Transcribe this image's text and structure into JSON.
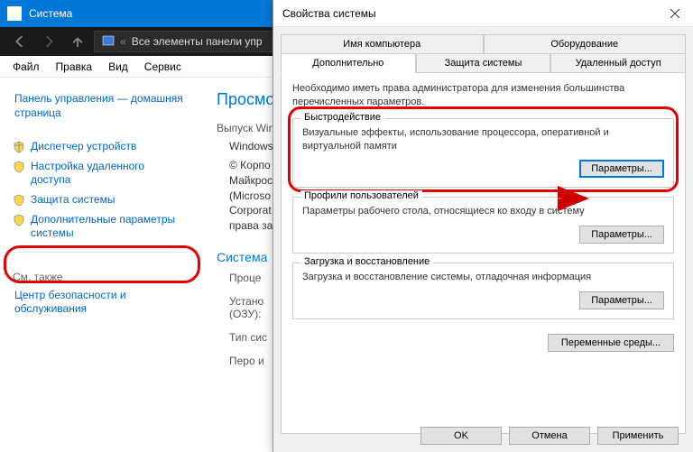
{
  "main_window": {
    "title": "Система",
    "address_crumb": "Все элементы панели упр",
    "menubar": [
      "Файл",
      "Правка",
      "Вид",
      "Сервис"
    ],
    "sidebar": {
      "home": "Панель управления — домашняя страница",
      "items": [
        "Диспетчер устройств",
        "Настройка удаленного доступа",
        "Защита системы",
        "Дополнительные параметры системы"
      ],
      "see_also_header": "См. также",
      "see_also": "Центр безопасности и обслуживания"
    },
    "main": {
      "heading": "Просмот",
      "edition_label": "Выпуск Win",
      "edition_value": "Windows",
      "copyright": "© Корпо\nМайкрос\n(Microso\nCorporat\nправа за",
      "system_header": "Система",
      "proc_label": "Проце",
      "ram_label": "Устано\n(ОЗУ):",
      "type_label": "Тип сис",
      "pen_label": "Перо и"
    }
  },
  "dialog": {
    "title": "Свойства системы",
    "tabs_row1": [
      "Имя компьютера",
      "Оборудование"
    ],
    "tabs_row2": [
      "Дополнительно",
      "Защита системы",
      "Удаленный доступ"
    ],
    "active_tab": "Дополнительно",
    "note": "Необходимо иметь права администратора для изменения большинства перечисленных параметров.",
    "groups": {
      "performance": {
        "legend": "Быстродействие",
        "desc": "Визуальные эффекты, использование процессора, оперативной и виртуальной памяти",
        "button": "Параметры..."
      },
      "profiles": {
        "legend": "Профили пользователей",
        "desc": "Параметры рабочего стола, относящиеся ко входу в систему",
        "button": "Параметры..."
      },
      "recovery": {
        "legend": "Загрузка и восстановление",
        "desc": "Загрузка и восстановление системы, отладочная информация",
        "button": "Параметры..."
      }
    },
    "envvars_button": "Переменные среды...",
    "buttons": {
      "ok": "OK",
      "cancel": "Отмена",
      "apply": "Применить"
    }
  }
}
